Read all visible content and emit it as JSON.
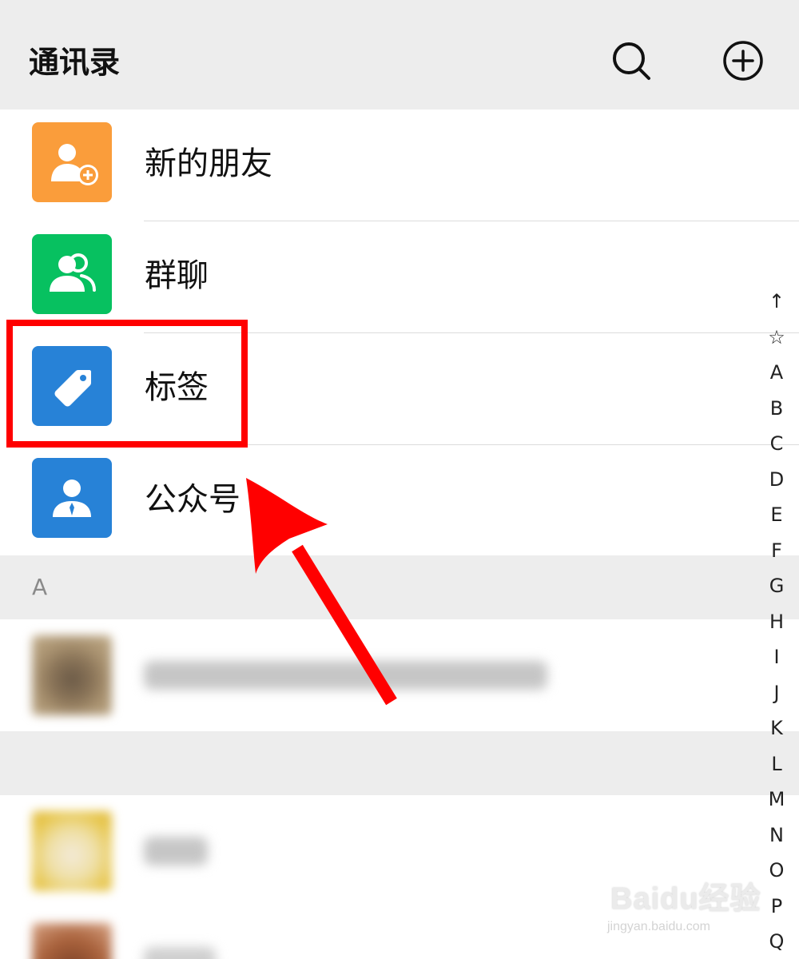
{
  "header": {
    "title": "通讯录",
    "search_icon": "search-icon",
    "add_icon": "plus-circle-icon"
  },
  "entries": [
    {
      "label": "新的朋友",
      "icon": "add-friend-icon",
      "color": "#fa9d3b"
    },
    {
      "label": "群聊",
      "icon": "group-chat-icon",
      "color": "#07c160"
    },
    {
      "label": "标签",
      "icon": "tag-icon",
      "color": "#2782d7"
    },
    {
      "label": "公众号",
      "icon": "official-account-icon",
      "color": "#2782d7"
    }
  ],
  "sections": [
    {
      "letter": "A"
    },
    {
      "letter": ""
    }
  ],
  "index_bar": [
    "↑",
    "☆",
    "A",
    "B",
    "C",
    "D",
    "E",
    "F",
    "G",
    "H",
    "I",
    "J",
    "K",
    "L",
    "M",
    "N",
    "O",
    "P",
    "Q"
  ],
  "watermark": {
    "logo_text": "Baidu经验",
    "url": "jingyan.baidu.com"
  },
  "colors": {
    "header_bg": "#ededed",
    "highlight": "#ff0000",
    "arrow": "#ff0000"
  }
}
